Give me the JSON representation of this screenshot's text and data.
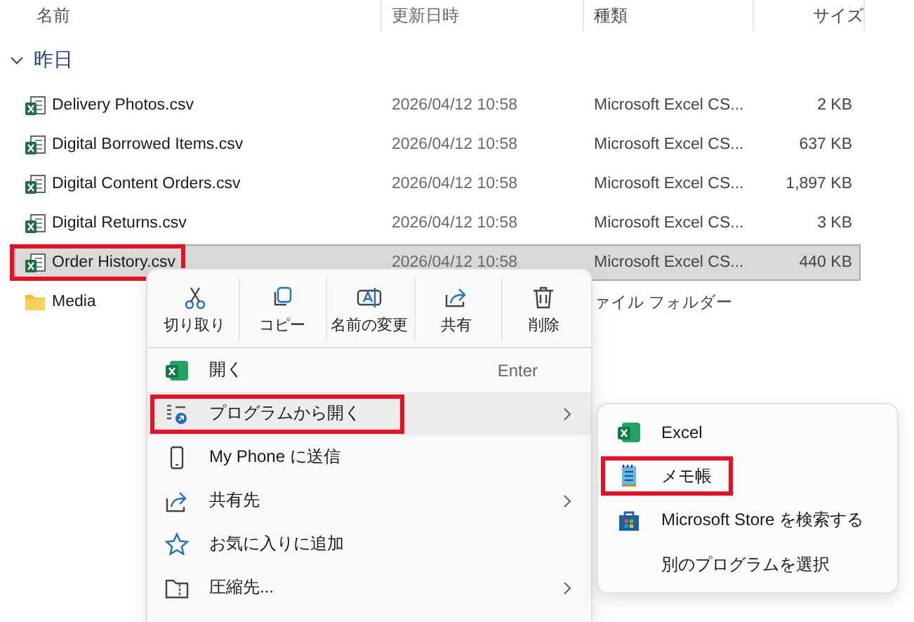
{
  "columns": [
    "名前",
    "更新日時",
    "種類",
    "サイズ"
  ],
  "group": {
    "label": "昨日",
    "expanded": true
  },
  "files": [
    {
      "kind": "csv",
      "name": "Delivery Photos.csv",
      "date": "2026/04/12 10:58",
      "type": "Microsoft Excel CS...",
      "size": "2 KB",
      "selected": false,
      "highlighted": false
    },
    {
      "kind": "csv",
      "name": "Digital Borrowed Items.csv",
      "date": "2026/04/12 10:58",
      "type": "Microsoft Excel CS...",
      "size": "637 KB",
      "selected": false,
      "highlighted": false
    },
    {
      "kind": "csv",
      "name": "Digital Content Orders.csv",
      "date": "2026/04/12 10:58",
      "type": "Microsoft Excel CS...",
      "size": "1,897 KB",
      "selected": false,
      "highlighted": false
    },
    {
      "kind": "csv",
      "name": "Digital Returns.csv",
      "date": "2026/04/12 10:58",
      "type": "Microsoft Excel CS...",
      "size": "3 KB",
      "selected": false,
      "highlighted": false
    },
    {
      "kind": "csv",
      "name": "Order History.csv",
      "date": "2026/04/12 10:58",
      "type": "Microsoft Excel CS...",
      "size": "440 KB",
      "selected": true,
      "highlighted": true
    },
    {
      "kind": "folder",
      "name": "Media",
      "type": "ァイル フォルダー",
      "selected": false,
      "highlighted": false
    }
  ],
  "context_menu": {
    "toolbar": [
      {
        "kind": "cut",
        "label": "切り取り"
      },
      {
        "kind": "copy",
        "label": "コピー"
      },
      {
        "kind": "rename",
        "label": "名前の変更"
      },
      {
        "kind": "share",
        "label": "共有"
      },
      {
        "kind": "delete",
        "label": "削除"
      }
    ],
    "items": [
      {
        "kind": "excel",
        "label": "開く",
        "shortcut": "Enter",
        "submenu": false,
        "selected": false,
        "highlighted": false
      },
      {
        "kind": "openwith",
        "label": "プログラムから開く",
        "submenu": true,
        "selected": true,
        "highlighted": true
      },
      {
        "kind": "phone",
        "label": "My Phone に送信",
        "submenu": false,
        "selected": false,
        "highlighted": false
      },
      {
        "kind": "share",
        "label": "共有先",
        "submenu": true,
        "selected": false,
        "highlighted": false
      },
      {
        "kind": "star",
        "label": "お気に入りに追加",
        "submenu": false,
        "selected": false,
        "highlighted": false
      },
      {
        "kind": "zip",
        "label": "圧縮先...",
        "submenu": true,
        "selected": false,
        "highlighted": false
      }
    ]
  },
  "submenu": {
    "items": [
      {
        "kind": "excel",
        "label": "Excel",
        "highlighted": false
      },
      {
        "kind": "notepad",
        "label": "メモ帳",
        "highlighted": true
      },
      {
        "kind": "store",
        "label": "Microsoft Store を検索する",
        "highlighted": false
      },
      {
        "kind": "none",
        "label": "別のプログラムを選択",
        "highlighted": false
      }
    ]
  }
}
